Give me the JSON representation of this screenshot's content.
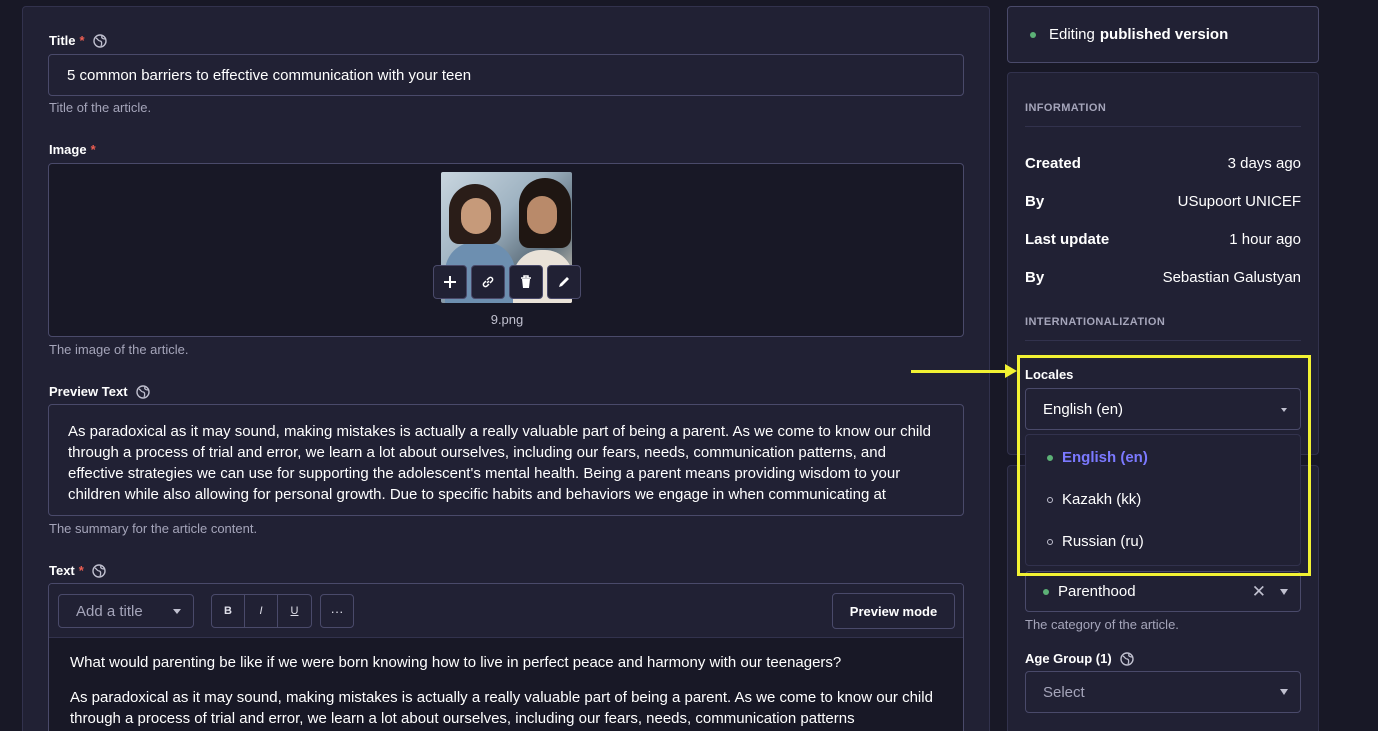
{
  "form": {
    "title_label": "Title",
    "title_required": "*",
    "title_value": "5 common barriers to effective communication with your teen",
    "title_hint": "Title of the article.",
    "image_label": "Image",
    "image_required": "*",
    "image_filename": "9.png",
    "image_hint": "The image of the article.",
    "preview_label": "Preview Text",
    "preview_value": "As paradoxical as it may sound, making mistakes is actually a really valuable part of being a parent. As we come to know our child through a process of trial and error, we learn a lot about ourselves, including our fears, needs, communication patterns, and effective strategies we can use for supporting the adolescent's mental health. Being a parent means providing wisdom to your children while also allowing for personal growth. Due to specific habits and behaviors we engage in when communicating at",
    "preview_hint": "The summary for the article content.",
    "text_label": "Text",
    "text_required": "*",
    "toolbar": {
      "heading_placeholder": "Add a title",
      "bold": "B",
      "italic": "I",
      "underline": "U",
      "more": "···",
      "preview_mode": "Preview mode"
    },
    "text_paragraph_1": "What would parenting be like if we were born knowing how to live in perfect peace and harmony with our teenagers?",
    "text_paragraph_2": "As paradoxical as it may sound, making mistakes is actually a really valuable part of being a parent. As we come to know our child through a process of trial and error, we learn a lot about ourselves, including our fears, needs, communication patterns"
  },
  "sidebar": {
    "status_prefix": "Editing",
    "status_strong": "published version",
    "information_heading": "INFORMATION",
    "info": [
      {
        "key": "Created",
        "value": "3 days ago"
      },
      {
        "key": "By",
        "value": "USupoort UNICEF"
      },
      {
        "key": "Last update",
        "value": "1 hour ago"
      },
      {
        "key": "By",
        "value": "Sebastian Galustyan"
      }
    ],
    "i18n_heading": "INTERNATIONALIZATION",
    "locales_label": "Locales",
    "locales_selected": "English (en)",
    "locale_options": [
      "English (en)",
      "Kazakh (kk)",
      "Russian (ru)"
    ],
    "category_value": "Parenthood",
    "category_hint": "The category of the article.",
    "age_group_label": "Age Group (1)",
    "age_group_placeholder": "Select"
  },
  "colors": {
    "background": "#181826",
    "panel": "#212134",
    "accent": "#7b79ff",
    "success": "#5cb176",
    "required": "#ee5e52",
    "annotation": "#f2f233"
  }
}
